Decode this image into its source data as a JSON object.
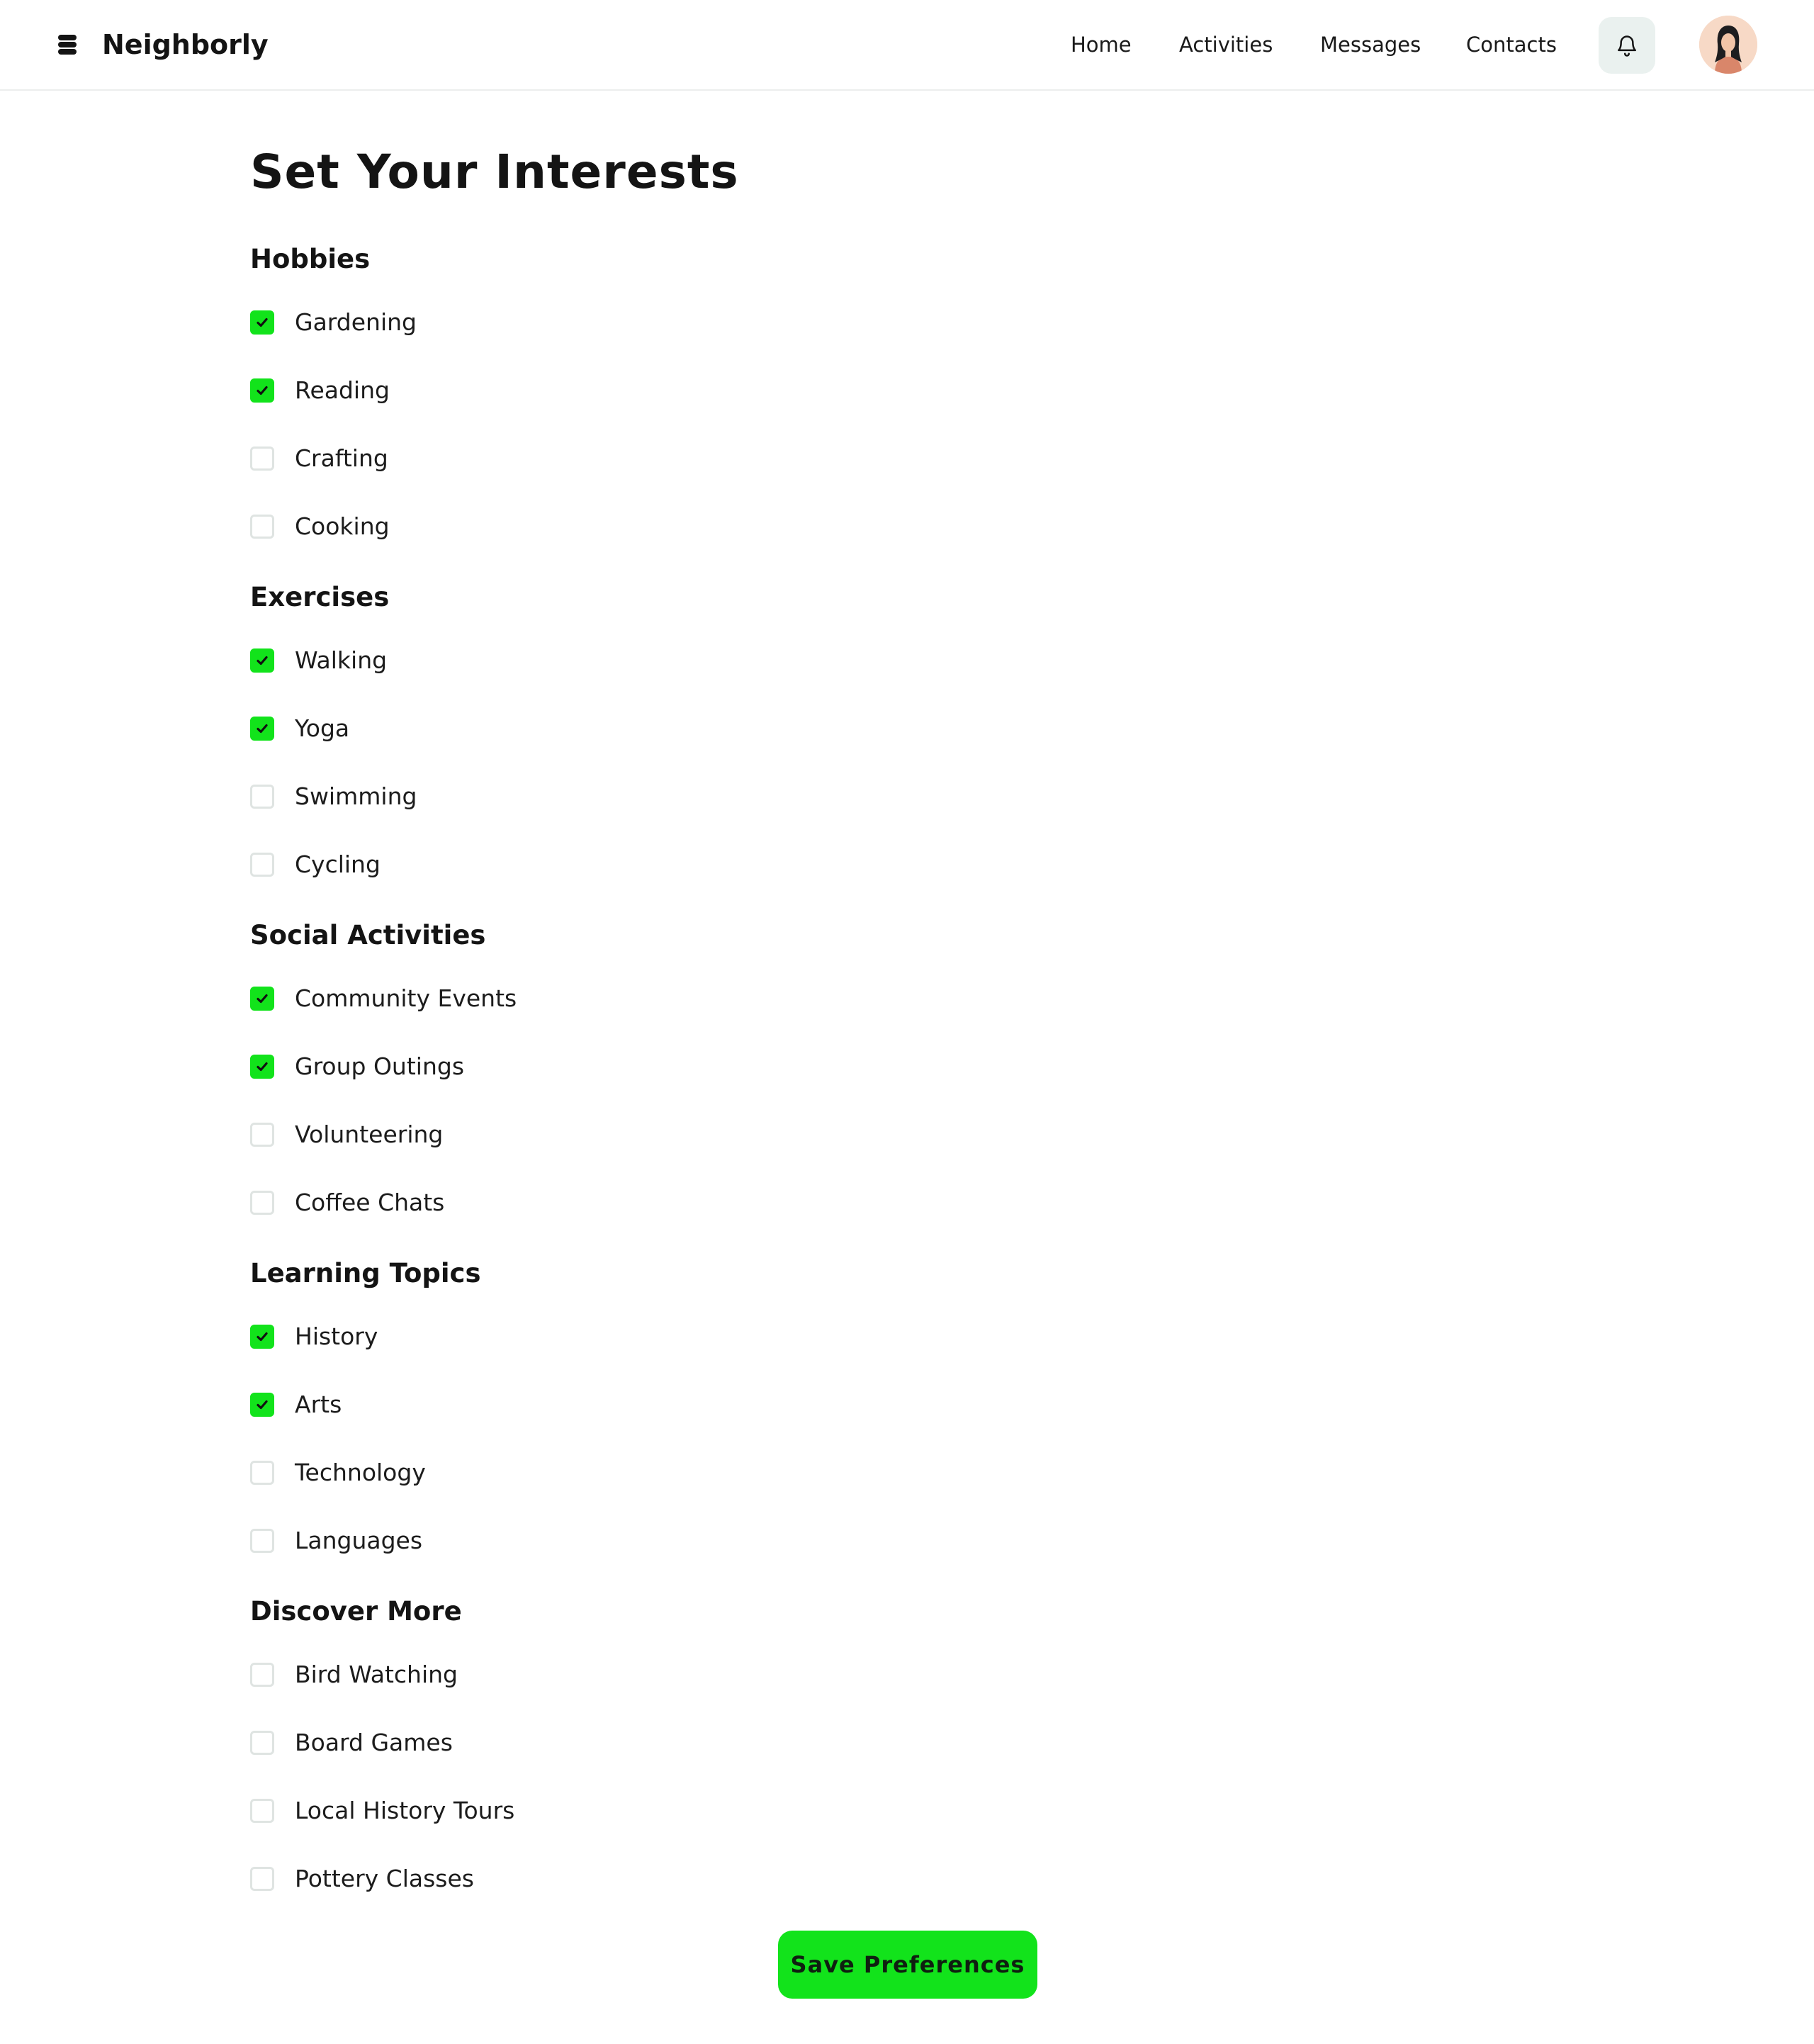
{
  "brand": {
    "name": "Neighborly",
    "logo_icon": "stacked-discs-icon"
  },
  "nav": {
    "items": [
      {
        "label": "Home"
      },
      {
        "label": "Activities"
      },
      {
        "label": "Messages"
      },
      {
        "label": "Contacts"
      }
    ],
    "notification_icon": "bell-icon",
    "avatar_icon": "user-avatar"
  },
  "page": {
    "title": "Set Your Interests"
  },
  "sections": [
    {
      "title": "Hobbies",
      "options": [
        {
          "label": "Gardening",
          "checked": true
        },
        {
          "label": "Reading",
          "checked": true
        },
        {
          "label": "Crafting",
          "checked": false
        },
        {
          "label": "Cooking",
          "checked": false
        }
      ]
    },
    {
      "title": "Exercises",
      "options": [
        {
          "label": "Walking",
          "checked": true
        },
        {
          "label": "Yoga",
          "checked": true
        },
        {
          "label": "Swimming",
          "checked": false
        },
        {
          "label": "Cycling",
          "checked": false
        }
      ]
    },
    {
      "title": "Social Activities",
      "options": [
        {
          "label": "Community Events",
          "checked": true
        },
        {
          "label": "Group Outings",
          "checked": true
        },
        {
          "label": "Volunteering",
          "checked": false
        },
        {
          "label": "Coffee Chats",
          "checked": false
        }
      ]
    },
    {
      "title": "Learning Topics",
      "options": [
        {
          "label": "History",
          "checked": true
        },
        {
          "label": "Arts",
          "checked": true
        },
        {
          "label": "Technology",
          "checked": false
        },
        {
          "label": "Languages",
          "checked": false
        }
      ]
    },
    {
      "title": "Discover More",
      "options": [
        {
          "label": "Bird Watching",
          "checked": false
        },
        {
          "label": "Board Games",
          "checked": false
        },
        {
          "label": "Local History Tours",
          "checked": false
        },
        {
          "label": "Pottery Classes",
          "checked": false
        }
      ]
    }
  ],
  "actions": {
    "save_label": "Save Preferences"
  },
  "colors": {
    "accent": "#12e31b",
    "checkbox_border": "#dfe4e2",
    "bell_bg": "#eaf1ef",
    "text": "#141414"
  }
}
